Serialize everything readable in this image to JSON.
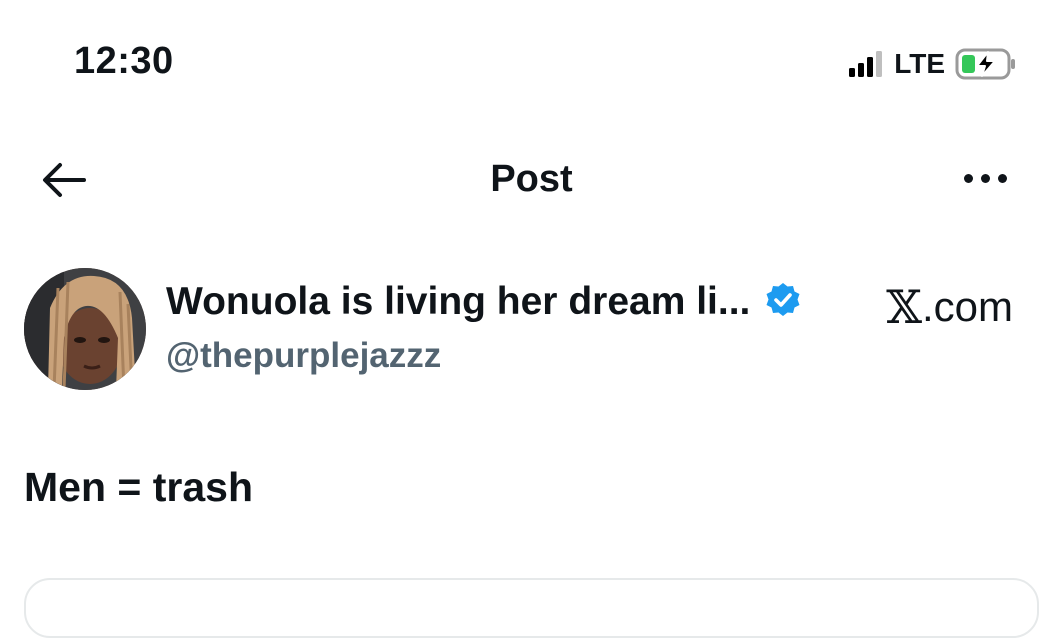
{
  "status_bar": {
    "time": "12:30",
    "network": "LTE",
    "icons": [
      "signal-icon",
      "battery-charging-icon"
    ]
  },
  "header": {
    "title": "Post",
    "icons": [
      "back-arrow-icon",
      "more-icon"
    ]
  },
  "post": {
    "author_name": "Wonuola is living her dream li...",
    "handle": "@thepurplejazzz",
    "source": ".com",
    "source_icon": "x-logo-icon",
    "text": "Men = trash"
  },
  "colors": {
    "text": "#0f1419",
    "handle": "#536471",
    "verified": "#1d9bf0",
    "battery_charge": "#34c759",
    "card_border": "#e6e9ea"
  }
}
